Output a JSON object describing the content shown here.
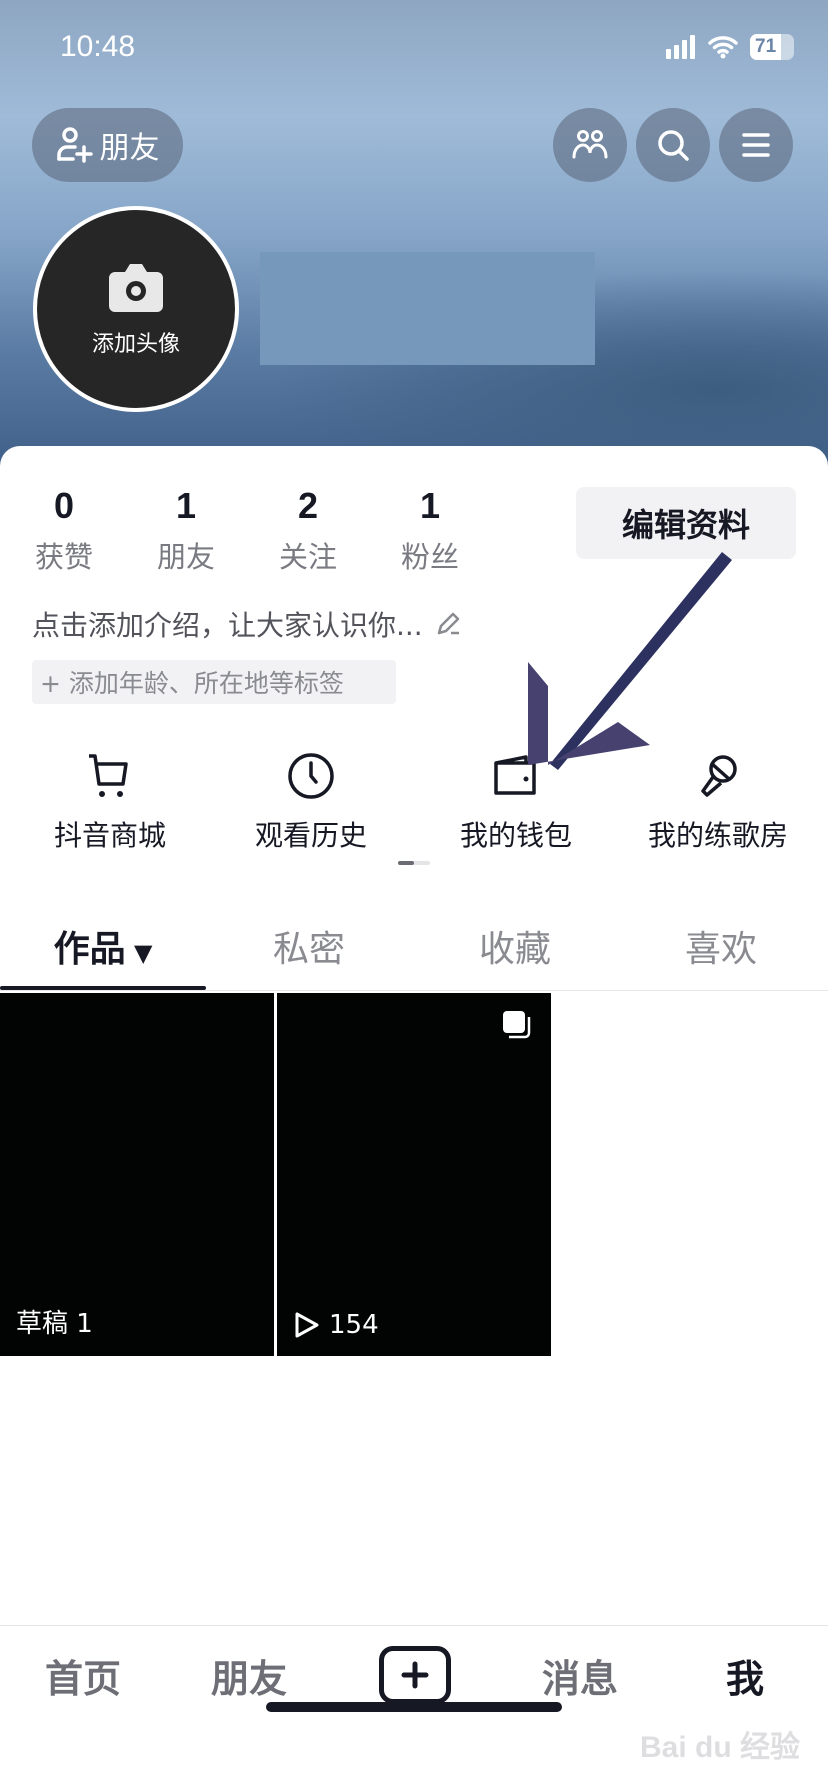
{
  "status_bar": {
    "time": "10:48",
    "battery": "71",
    "battery_level": 0.71
  },
  "header": {
    "friend_button": "朋友",
    "icons": [
      "friends-icon",
      "search-icon",
      "menu-icon"
    ]
  },
  "profile": {
    "avatar_label": "添加头像",
    "edit_button": "编辑资料",
    "stats": [
      {
        "value": "0",
        "label": "获赞"
      },
      {
        "value": "1",
        "label": "朋友"
      },
      {
        "value": "2",
        "label": "关注"
      },
      {
        "value": "1",
        "label": "粉丝"
      }
    ],
    "bio": "点击添加介绍，让大家认识你...",
    "tag_chip": "+ 添加年龄、所在地等标签"
  },
  "shortcuts": [
    {
      "label": "抖音商城",
      "icon": "cart-icon"
    },
    {
      "label": "观看历史",
      "icon": "clock-icon"
    },
    {
      "label": "我的钱包",
      "icon": "wallet-icon"
    },
    {
      "label": "我的练歌房",
      "icon": "microphone-icon"
    }
  ],
  "tabs": [
    {
      "label": "作品"
    },
    {
      "label": "私密"
    },
    {
      "label": "收藏"
    },
    {
      "label": "喜欢"
    }
  ],
  "grid": [
    {
      "caption": "草稿 1"
    },
    {
      "caption": "154"
    }
  ],
  "bottom_nav": [
    {
      "label": "首页"
    },
    {
      "label": "朋友"
    },
    {
      "label": "消息"
    },
    {
      "label": "我"
    }
  ],
  "watermark": "Baidu经验",
  "colors": {
    "annotation_arrow": "#3a3868",
    "text": "#161823"
  }
}
